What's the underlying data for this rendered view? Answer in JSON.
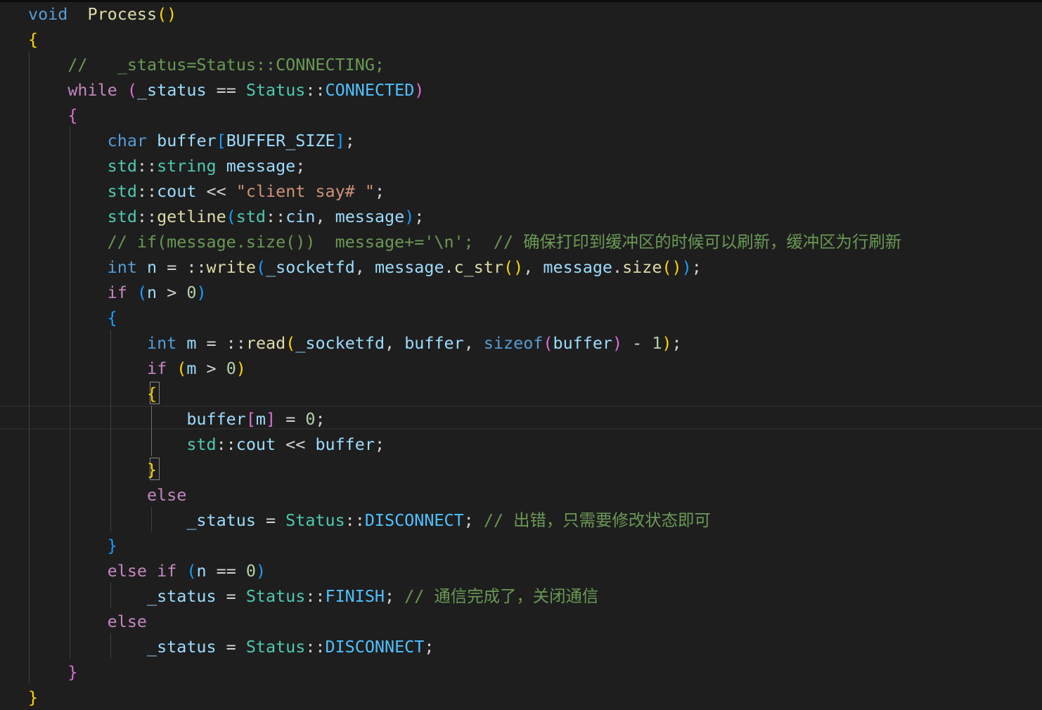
{
  "editor": {
    "lines": [
      [
        [
          "kw",
          "void"
        ],
        [
          "",
          "  "
        ],
        [
          "fn",
          "Process"
        ],
        [
          "b1",
          "()"
        ]
      ],
      [
        [
          "b1",
          "{"
        ]
      ],
      [
        [
          "",
          "    "
        ],
        [
          "cmt",
          "//   _status=Status::CONNECTING;"
        ]
      ],
      [
        [
          "",
          "    "
        ],
        [
          "ctl",
          "while"
        ],
        [
          "",
          " "
        ],
        [
          "b2",
          "("
        ],
        [
          "var",
          "_status"
        ],
        [
          "",
          " == "
        ],
        [
          "typ",
          "Status"
        ],
        [
          "",
          "::"
        ],
        [
          "con",
          "CONNECTED"
        ],
        [
          "b2",
          ")"
        ]
      ],
      [
        [
          "",
          "    "
        ],
        [
          "b2",
          "{"
        ]
      ],
      [
        [
          "",
          "        "
        ],
        [
          "kw",
          "char"
        ],
        [
          "",
          " "
        ],
        [
          "var",
          "buffer"
        ],
        [
          "b3",
          "["
        ],
        [
          "var",
          "BUFFER_SIZE"
        ],
        [
          "b3",
          "]"
        ],
        [
          "",
          ";"
        ]
      ],
      [
        [
          "",
          "        "
        ],
        [
          "typ",
          "std"
        ],
        [
          "",
          "::"
        ],
        [
          "typ",
          "string"
        ],
        [
          "",
          " "
        ],
        [
          "var",
          "message"
        ],
        [
          "",
          ";"
        ]
      ],
      [
        [
          "",
          "        "
        ],
        [
          "typ",
          "std"
        ],
        [
          "",
          "::"
        ],
        [
          "var",
          "cout"
        ],
        [
          "",
          " << "
        ],
        [
          "str",
          "\"client say# \""
        ],
        [
          "",
          ";"
        ]
      ],
      [
        [
          "",
          "        "
        ],
        [
          "typ",
          "std"
        ],
        [
          "",
          "::"
        ],
        [
          "fn",
          "getline"
        ],
        [
          "b3",
          "("
        ],
        [
          "typ",
          "std"
        ],
        [
          "",
          "::"
        ],
        [
          "var",
          "cin"
        ],
        [
          "",
          ", "
        ],
        [
          "var",
          "message"
        ],
        [
          "b3",
          ")"
        ],
        [
          "",
          ";"
        ]
      ],
      [
        [
          "",
          "        "
        ],
        [
          "cmt",
          "// if(message.size())  message+='\\n';  // 确保打印到缓冲区的时候可以刷新，缓冲区为行刷新"
        ]
      ],
      [
        [
          "",
          "        "
        ],
        [
          "kw",
          "int"
        ],
        [
          "",
          " "
        ],
        [
          "var",
          "n"
        ],
        [
          "",
          " = ::"
        ],
        [
          "fn",
          "write"
        ],
        [
          "b3",
          "("
        ],
        [
          "var",
          "_socketfd"
        ],
        [
          "",
          ", "
        ],
        [
          "var",
          "message"
        ],
        [
          "",
          "."
        ],
        [
          "fn",
          "c_str"
        ],
        [
          "b1",
          "()"
        ],
        [
          "",
          ", "
        ],
        [
          "var",
          "message"
        ],
        [
          "",
          "."
        ],
        [
          "fn",
          "size"
        ],
        [
          "b1",
          "()"
        ],
        [
          "b3",
          ")"
        ],
        [
          "",
          ";"
        ]
      ],
      [
        [
          "",
          "        "
        ],
        [
          "ctl",
          "if"
        ],
        [
          "",
          " "
        ],
        [
          "b3",
          "("
        ],
        [
          "var",
          "n"
        ],
        [
          "",
          " > "
        ],
        [
          "num",
          "0"
        ],
        [
          "b3",
          ")"
        ]
      ],
      [
        [
          "",
          "        "
        ],
        [
          "b3",
          "{"
        ]
      ],
      [
        [
          "",
          "            "
        ],
        [
          "kw",
          "int"
        ],
        [
          "",
          " "
        ],
        [
          "var",
          "m"
        ],
        [
          "",
          " = ::"
        ],
        [
          "fn",
          "read"
        ],
        [
          "b1",
          "("
        ],
        [
          "var",
          "_socketfd"
        ],
        [
          "",
          ", "
        ],
        [
          "var",
          "buffer"
        ],
        [
          "",
          ", "
        ],
        [
          "kw",
          "sizeof"
        ],
        [
          "b2",
          "("
        ],
        [
          "var",
          "buffer"
        ],
        [
          "b2",
          ")"
        ],
        [
          "",
          " - "
        ],
        [
          "num",
          "1"
        ],
        [
          "b1",
          ")"
        ],
        [
          "",
          ";"
        ]
      ],
      [
        [
          "",
          "            "
        ],
        [
          "ctl",
          "if"
        ],
        [
          "",
          " "
        ],
        [
          "b1",
          "("
        ],
        [
          "var",
          "m"
        ],
        [
          "",
          " > "
        ],
        [
          "num",
          "0"
        ],
        [
          "b1",
          ")"
        ]
      ],
      [
        [
          "",
          "            "
        ],
        [
          "b1",
          "{"
        ]
      ],
      [
        [
          "",
          "                "
        ],
        [
          "var",
          "buffer"
        ],
        [
          "b2",
          "["
        ],
        [
          "var",
          "m"
        ],
        [
          "b2",
          "]"
        ],
        [
          "",
          " = "
        ],
        [
          "num",
          "0"
        ],
        [
          "",
          ";"
        ]
      ],
      [
        [
          "",
          "                "
        ],
        [
          "typ",
          "std"
        ],
        [
          "",
          "::"
        ],
        [
          "var",
          "cout"
        ],
        [
          "",
          " << "
        ],
        [
          "var",
          "buffer"
        ],
        [
          "",
          ";"
        ]
      ],
      [
        [
          "",
          "            "
        ],
        [
          "b1",
          "}"
        ]
      ],
      [
        [
          "",
          "            "
        ],
        [
          "ctl",
          "else"
        ]
      ],
      [
        [
          "",
          "                "
        ],
        [
          "var",
          "_status"
        ],
        [
          "",
          " = "
        ],
        [
          "typ",
          "Status"
        ],
        [
          "",
          "::"
        ],
        [
          "con",
          "DISCONNECT"
        ],
        [
          "",
          "; "
        ],
        [
          "cmt",
          "// 出错，只需要修改状态即可"
        ]
      ],
      [
        [
          "",
          "        "
        ],
        [
          "b3",
          "}"
        ]
      ],
      [
        [
          "",
          "        "
        ],
        [
          "ctl",
          "else"
        ],
        [
          "",
          " "
        ],
        [
          "ctl",
          "if"
        ],
        [
          "",
          " "
        ],
        [
          "b3",
          "("
        ],
        [
          "var",
          "n"
        ],
        [
          "",
          " == "
        ],
        [
          "num",
          "0"
        ],
        [
          "b3",
          ")"
        ]
      ],
      [
        [
          "",
          "            "
        ],
        [
          "var",
          "_status"
        ],
        [
          "",
          " = "
        ],
        [
          "typ",
          "Status"
        ],
        [
          "",
          "::"
        ],
        [
          "con",
          "FINISH"
        ],
        [
          "",
          "; "
        ],
        [
          "cmt",
          "// 通信完成了，关闭通信"
        ]
      ],
      [
        [
          "",
          "        "
        ],
        [
          "ctl",
          "else"
        ]
      ],
      [
        [
          "",
          "            "
        ],
        [
          "var",
          "_status"
        ],
        [
          "",
          " = "
        ],
        [
          "typ",
          "Status"
        ],
        [
          "",
          "::"
        ],
        [
          "con",
          "DISCONNECT"
        ],
        [
          "",
          ";"
        ]
      ],
      [
        [
          "",
          "    "
        ],
        [
          "b2",
          "}"
        ]
      ],
      [
        [
          "b1",
          "}"
        ]
      ]
    ]
  }
}
